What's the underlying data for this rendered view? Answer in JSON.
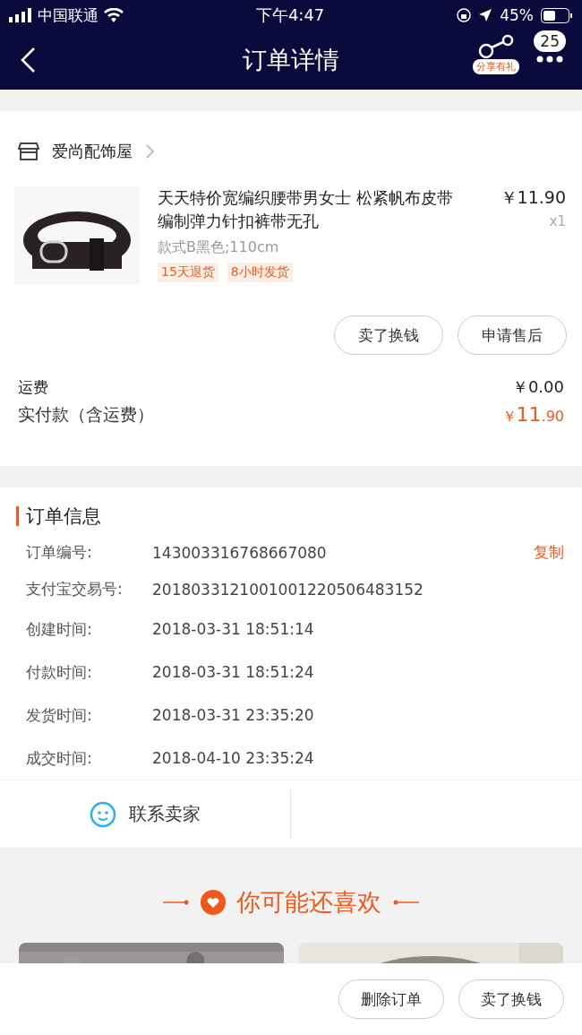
{
  "status_bar": {
    "carrier": "中国联通",
    "time": "下午4:47",
    "battery": "45%"
  },
  "nav": {
    "title": "订单详情",
    "share_label": "分享有礼",
    "badge": "25"
  },
  "shop": {
    "name": "爱尚配饰屋"
  },
  "item": {
    "kind": "picture",
    "title": "天天特价宽编织腰带男女士 松紧帆布皮带编制弹力针扣裤带无孔",
    "spec": "款式B黑色;110cm",
    "price": "￥11.90",
    "qty": "x1",
    "tags": [
      "15天退货",
      "8小时发货"
    ]
  },
  "item_actions": [
    "卖了换钱",
    "申请售后"
  ],
  "shipping": {
    "label": "运费",
    "value": "￥0.00"
  },
  "paid": {
    "label": "实付款（含运费）",
    "currency": "￥",
    "integer": "11",
    "decimal": ".90"
  },
  "order_info": {
    "title": "订单信息",
    "copy": "复制",
    "rows": [
      {
        "label": "订单编号:",
        "value": "143003316768667080"
      },
      {
        "label": "支付宝交易号:",
        "value": "2018033121001001220506483152"
      },
      {
        "label": "创建时间:",
        "value": "2018-03-31 18:51:14"
      },
      {
        "label": "付款时间:",
        "value": "2018-03-31 18:51:24"
      },
      {
        "label": "发货时间:",
        "value": "2018-03-31 23:35:20"
      },
      {
        "label": "成交时间:",
        "value": "2018-04-10 23:35:24"
      }
    ]
  },
  "contact": "联系卖家",
  "recommend": {
    "title": "你可能还喜欢"
  },
  "bottom_actions": [
    "删除订单",
    "卖了换钱"
  ]
}
